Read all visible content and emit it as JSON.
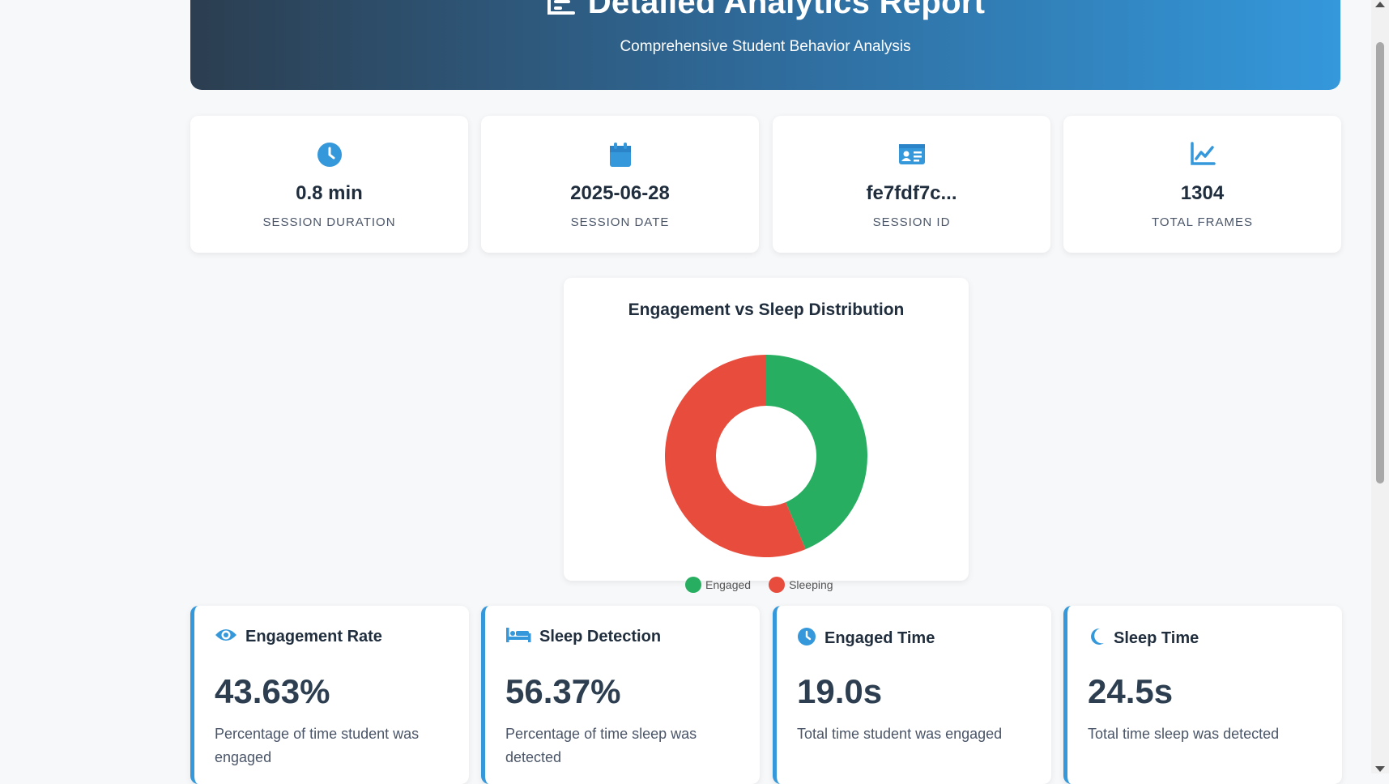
{
  "header": {
    "title": "Detailed Analytics Report",
    "subtitle": "Comprehensive Student Behavior Analysis",
    "icon": "report-icon"
  },
  "stats": [
    {
      "icon": "clock-icon",
      "value": "0.8 min",
      "label": "SESSION DURATION"
    },
    {
      "icon": "calendar-icon",
      "value": "2025-06-28",
      "label": "SESSION DATE"
    },
    {
      "icon": "id-card-icon",
      "value": "fe7fdf7c...",
      "label": "SESSION ID"
    },
    {
      "icon": "chart-line-icon",
      "value": "1304",
      "label": "TOTAL FRAMES"
    }
  ],
  "chart_data": {
    "type": "pie",
    "title": "Engagement vs Sleep Distribution",
    "categories": [
      "Engaged",
      "Sleeping"
    ],
    "values": [
      43.63,
      56.37
    ],
    "colors": [
      "#27ae60",
      "#e74c3c"
    ],
    "legend_position": "bottom"
  },
  "metrics": [
    {
      "icon": "eye-icon",
      "title": "Engagement Rate",
      "value": "43.63%",
      "desc": "Percentage of time student was engaged"
    },
    {
      "icon": "bed-icon",
      "title": "Sleep Detection",
      "value": "56.37%",
      "desc": "Percentage of time sleep was detected"
    },
    {
      "icon": "clock-icon",
      "title": "Engaged Time",
      "value": "19.0s",
      "desc": "Total time student was engaged"
    },
    {
      "icon": "moon-icon",
      "title": "Sleep Time",
      "value": "24.5s",
      "desc": "Total time sleep was detected"
    }
  ],
  "colors": {
    "accent": "#3498db",
    "engaged": "#27ae60",
    "sleeping": "#e74c3c"
  }
}
